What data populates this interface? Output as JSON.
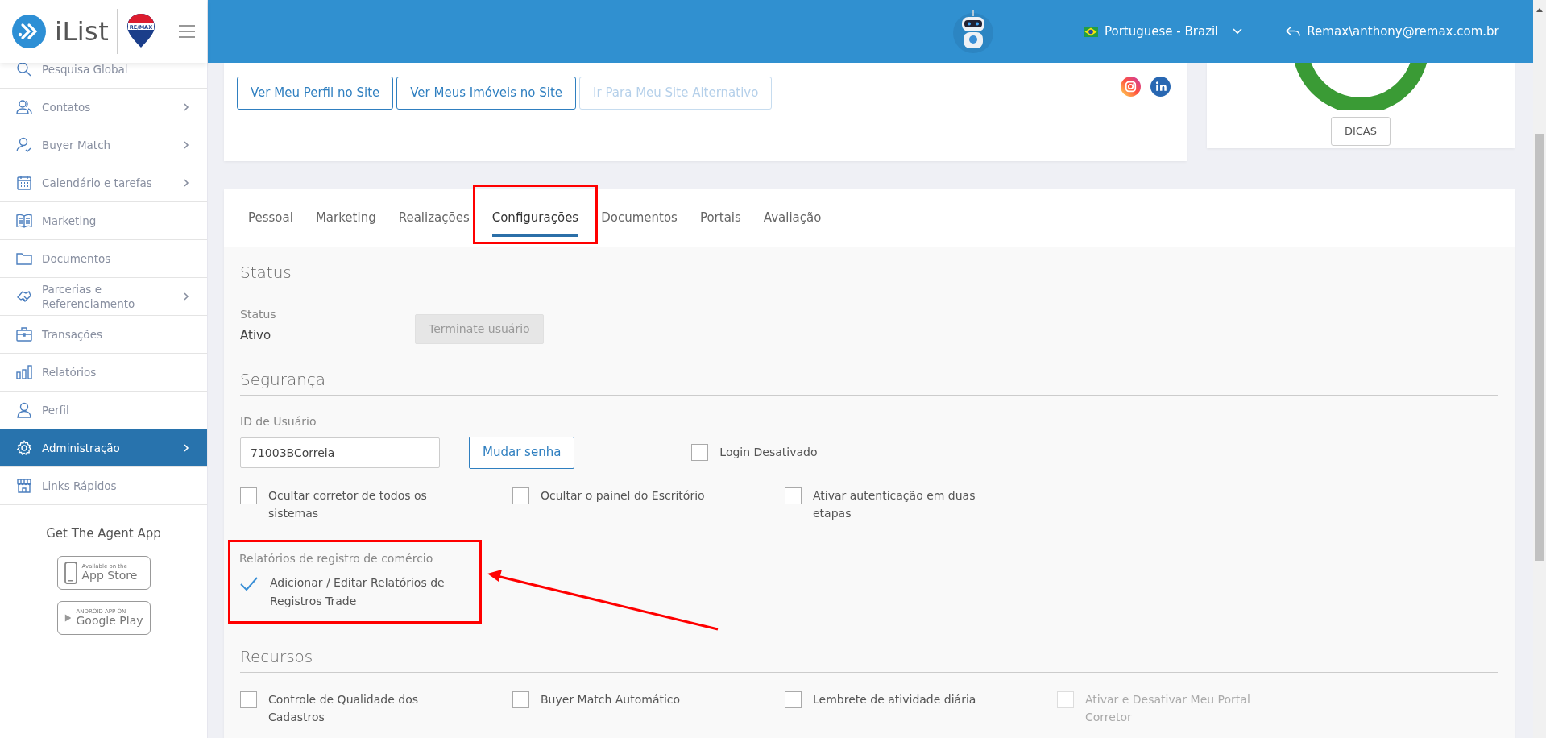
{
  "sidebar": {
    "brand": "iList",
    "partner_logo": "RE/MAX",
    "items": [
      {
        "label": "Pesquisa Global",
        "submenu": false,
        "selected": false
      },
      {
        "label": "Contatos",
        "submenu": true,
        "selected": false
      },
      {
        "label": "Buyer Match",
        "submenu": true,
        "selected": false
      },
      {
        "label": "Calendário e tarefas",
        "submenu": true,
        "selected": false
      },
      {
        "label": "Marketing",
        "submenu": false,
        "selected": false
      },
      {
        "label": "Documentos",
        "submenu": false,
        "selected": false
      },
      {
        "label": "Parcerias e Referenciamento",
        "submenu": true,
        "selected": false
      },
      {
        "label": "Transações",
        "submenu": false,
        "selected": false
      },
      {
        "label": "Relatórios",
        "submenu": false,
        "selected": false
      },
      {
        "label": "Perfil",
        "submenu": false,
        "selected": false
      },
      {
        "label": "Administração",
        "submenu": true,
        "selected": true
      },
      {
        "label": "Links Rápidos",
        "submenu": false,
        "selected": false
      }
    ],
    "app_promo": {
      "title": "Get The Agent App",
      "badges": [
        {
          "kind": "apple",
          "small": "Available on the",
          "big": "App Store"
        },
        {
          "kind": "google",
          "small": "ANDROID APP ON",
          "big": "Google Play"
        }
      ]
    }
  },
  "header": {
    "language": "Portuguese - Brazil",
    "user": "Remax\\anthony@remax.com.br"
  },
  "profile_buttons": [
    {
      "label": "Ver Meu Perfil no Site",
      "disabled": false
    },
    {
      "label": "Ver Meus Imóveis no Site",
      "disabled": false
    },
    {
      "label": "Ir Para Meu Site Alternativo",
      "disabled": true
    }
  ],
  "score_card": {
    "button": "DICAS"
  },
  "tabs": [
    {
      "label": "Pessoal",
      "selected": false
    },
    {
      "label": "Marketing",
      "selected": false
    },
    {
      "label": "Realizações",
      "selected": false
    },
    {
      "label": "Configurações",
      "selected": true
    },
    {
      "label": "Documentos",
      "selected": false
    },
    {
      "label": "Portais",
      "selected": false
    },
    {
      "label": "Avaliação",
      "selected": false
    }
  ],
  "status": {
    "title": "Status",
    "field_label": "Status",
    "value": "Ativo",
    "button": {
      "label": "Terminate usuário",
      "disabled": true
    }
  },
  "security": {
    "title": "Segurança",
    "user_id": {
      "label": "ID de Usuário",
      "value": "71003BCorreia"
    },
    "change_password": "Mudar senha",
    "login_option": {
      "label": "Login Desativado",
      "checked": false,
      "disabled": false
    },
    "options": [
      {
        "label": "Ocultar corretor de todos os sistemas",
        "checked": false,
        "disabled": false
      },
      {
        "label": "Ocultar o painel do Escritório",
        "checked": false,
        "disabled": false
      },
      {
        "label": "Ativar autenticação em duas etapas",
        "checked": false,
        "disabled": false
      }
    ]
  },
  "trade": {
    "title": "Relatórios de registro de comércio",
    "options": [
      {
        "label": "Adicionar / Editar Relatórios de Registros Trade",
        "checked": true,
        "disabled": false
      }
    ]
  },
  "resources": {
    "title": "Recursos",
    "options": [
      {
        "label": "Controle de Qualidade dos Cadastros",
        "checked": false,
        "disabled": false
      },
      {
        "label": "Buyer Match Automático",
        "checked": false,
        "disabled": false
      },
      {
        "label": "Lembrete de atividade diária",
        "checked": false,
        "disabled": false
      },
      {
        "label": "Ativar e Desativar Meu Portal Corretor",
        "checked": false,
        "disabled": true
      }
    ]
  }
}
